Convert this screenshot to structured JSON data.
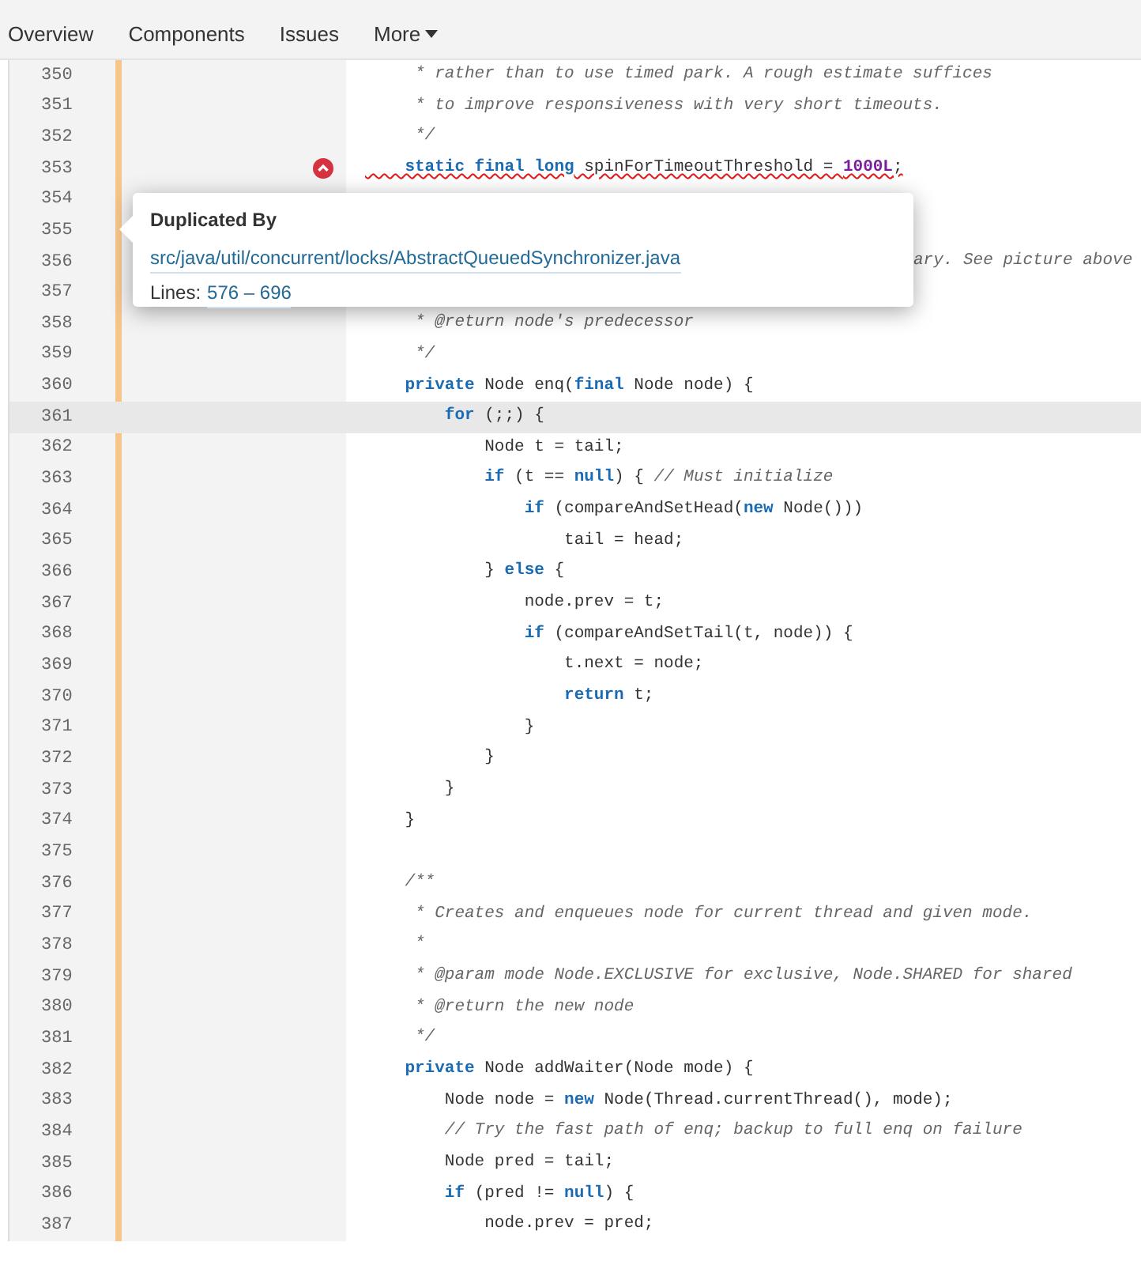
{
  "nav": {
    "items": [
      {
        "label": "Overview"
      },
      {
        "label": "Components"
      },
      {
        "label": "Issues"
      },
      {
        "label": "More",
        "kind": "dropdown"
      }
    ]
  },
  "popup": {
    "title": "Duplicated By",
    "link": "src/java/util/concurrent/locks/AbstractQueuedSynchronizer.java",
    "lines_label": "Lines:",
    "lines_range": "576 – 696"
  },
  "code": {
    "lines": [
      {
        "number": "350",
        "issue": false,
        "highlighted": false,
        "segments": [
          {
            "kind": "comment",
            "text": "     * rather than to use timed park. A rough estimate suffices"
          }
        ]
      },
      {
        "number": "351",
        "issue": false,
        "highlighted": false,
        "segments": [
          {
            "kind": "comment",
            "text": "     * to improve responsiveness with very short timeouts."
          }
        ]
      },
      {
        "number": "352",
        "issue": false,
        "highlighted": false,
        "segments": [
          {
            "kind": "comment",
            "text": "     */"
          }
        ]
      },
      {
        "number": "353",
        "issue": true,
        "highlighted": false,
        "segments": [
          {
            "kind": "keyword",
            "text": "    static final long"
          },
          {
            "kind": "plain",
            "text": " spinForTimeoutThreshold = "
          },
          {
            "kind": "number",
            "text": "1000L"
          },
          {
            "kind": "plain",
            "text": ";"
          }
        ]
      },
      {
        "number": "354",
        "issue": false,
        "highlighted": false
      },
      {
        "number": "355",
        "issue": false,
        "highlighted": false
      },
      {
        "number": "356",
        "issue": false,
        "highlighted": false,
        "partially_hidden": true,
        "segments": [
          {
            "kind": "comment",
            "text": "ary. See picture above"
          }
        ]
      },
      {
        "number": "357",
        "issue": false,
        "highlighted": false
      },
      {
        "number": "358",
        "issue": false,
        "highlighted": false,
        "segments": [
          {
            "kind": "comment",
            "text": "     * @return node's predecessor"
          }
        ]
      },
      {
        "number": "359",
        "issue": false,
        "highlighted": false,
        "segments": [
          {
            "kind": "comment",
            "text": "     */"
          }
        ]
      },
      {
        "number": "360",
        "issue": false,
        "highlighted": false,
        "segments": [
          {
            "kind": "keyword",
            "text": "    private"
          },
          {
            "kind": "plain",
            "text": " Node enq("
          },
          {
            "kind": "keyword",
            "text": "final"
          },
          {
            "kind": "plain",
            "text": " Node node) {"
          }
        ]
      },
      {
        "number": "361",
        "issue": false,
        "highlighted": true,
        "segments": [
          {
            "kind": "keyword",
            "text": "        for"
          },
          {
            "kind": "plain",
            "text": " (;;) {"
          }
        ]
      },
      {
        "number": "362",
        "issue": false,
        "highlighted": false,
        "segments": [
          {
            "kind": "plain",
            "text": "            Node t = tail;"
          }
        ]
      },
      {
        "number": "363",
        "issue": false,
        "highlighted": false,
        "segments": [
          {
            "kind": "keyword",
            "text": "            if"
          },
          {
            "kind": "plain",
            "text": " (t == "
          },
          {
            "kind": "keyword",
            "text": "null"
          },
          {
            "kind": "plain",
            "text": ") { "
          },
          {
            "kind": "comment",
            "text": "// Must initialize"
          }
        ]
      },
      {
        "number": "364",
        "issue": false,
        "highlighted": false,
        "segments": [
          {
            "kind": "keyword",
            "text": "                if"
          },
          {
            "kind": "plain",
            "text": " (compareAndSetHead("
          },
          {
            "kind": "keyword",
            "text": "new"
          },
          {
            "kind": "plain",
            "text": " Node()))"
          }
        ]
      },
      {
        "number": "365",
        "issue": false,
        "highlighted": false,
        "segments": [
          {
            "kind": "plain",
            "text": "                    tail = head;"
          }
        ]
      },
      {
        "number": "366",
        "issue": false,
        "highlighted": false,
        "segments": [
          {
            "kind": "plain",
            "text": "            } "
          },
          {
            "kind": "keyword",
            "text": "else"
          },
          {
            "kind": "plain",
            "text": " {"
          }
        ]
      },
      {
        "number": "367",
        "issue": false,
        "highlighted": false,
        "segments": [
          {
            "kind": "plain",
            "text": "                node.prev = t;"
          }
        ]
      },
      {
        "number": "368",
        "issue": false,
        "highlighted": false,
        "segments": [
          {
            "kind": "keyword",
            "text": "                if"
          },
          {
            "kind": "plain",
            "text": " (compareAndSetTail(t, node)) {"
          }
        ]
      },
      {
        "number": "369",
        "issue": false,
        "highlighted": false,
        "segments": [
          {
            "kind": "plain",
            "text": "                    t.next = node;"
          }
        ]
      },
      {
        "number": "370",
        "issue": false,
        "highlighted": false,
        "segments": [
          {
            "kind": "keyword",
            "text": "                    return"
          },
          {
            "kind": "plain",
            "text": " t;"
          }
        ]
      },
      {
        "number": "371",
        "issue": false,
        "highlighted": false,
        "segments": [
          {
            "kind": "plain",
            "text": "                }"
          }
        ]
      },
      {
        "number": "372",
        "issue": false,
        "highlighted": false,
        "segments": [
          {
            "kind": "plain",
            "text": "            }"
          }
        ]
      },
      {
        "number": "373",
        "issue": false,
        "highlighted": false,
        "segments": [
          {
            "kind": "plain",
            "text": "        }"
          }
        ]
      },
      {
        "number": "374",
        "issue": false,
        "highlighted": false,
        "segments": [
          {
            "kind": "plain",
            "text": "    }"
          }
        ]
      },
      {
        "number": "375",
        "issue": false,
        "highlighted": false
      },
      {
        "number": "376",
        "issue": false,
        "highlighted": false,
        "segments": [
          {
            "kind": "comment",
            "text": "    /**"
          }
        ]
      },
      {
        "number": "377",
        "issue": false,
        "highlighted": false,
        "segments": [
          {
            "kind": "comment",
            "text": "     * Creates and enqueues node for current thread and given mode."
          }
        ]
      },
      {
        "number": "378",
        "issue": false,
        "highlighted": false,
        "segments": [
          {
            "kind": "comment",
            "text": "     *"
          }
        ]
      },
      {
        "number": "379",
        "issue": false,
        "highlighted": false,
        "segments": [
          {
            "kind": "comment",
            "text": "     * @param mode Node.EXCLUSIVE for exclusive, Node.SHARED for shared"
          }
        ]
      },
      {
        "number": "380",
        "issue": false,
        "highlighted": false,
        "segments": [
          {
            "kind": "comment",
            "text": "     * @return the new node"
          }
        ]
      },
      {
        "number": "381",
        "issue": false,
        "highlighted": false,
        "segments": [
          {
            "kind": "comment",
            "text": "     */"
          }
        ]
      },
      {
        "number": "382",
        "issue": false,
        "highlighted": false,
        "segments": [
          {
            "kind": "keyword",
            "text": "    private"
          },
          {
            "kind": "plain",
            "text": " Node addWaiter(Node mode) {"
          }
        ]
      },
      {
        "number": "383",
        "issue": false,
        "highlighted": false,
        "segments": [
          {
            "kind": "plain",
            "text": "        Node node = "
          },
          {
            "kind": "keyword",
            "text": "new"
          },
          {
            "kind": "plain",
            "text": " Node(Thread.currentThread(), mode);"
          }
        ]
      },
      {
        "number": "384",
        "issue": false,
        "highlighted": false,
        "segments": [
          {
            "kind": "comment",
            "text": "        // Try the fast path of enq; backup to full enq on failure"
          }
        ]
      },
      {
        "number": "385",
        "issue": false,
        "highlighted": false,
        "segments": [
          {
            "kind": "plain",
            "text": "        Node pred = tail;"
          }
        ]
      },
      {
        "number": "386",
        "issue": false,
        "highlighted": false,
        "segments": [
          {
            "kind": "keyword",
            "text": "        if"
          },
          {
            "kind": "plain",
            "text": " (pred != "
          },
          {
            "kind": "keyword",
            "text": "null"
          },
          {
            "kind": "plain",
            "text": ") {"
          }
        ]
      },
      {
        "number": "387",
        "issue": false,
        "highlighted": false,
        "segments": [
          {
            "kind": "plain",
            "text": "            node.prev = pred;"
          }
        ]
      }
    ]
  }
}
